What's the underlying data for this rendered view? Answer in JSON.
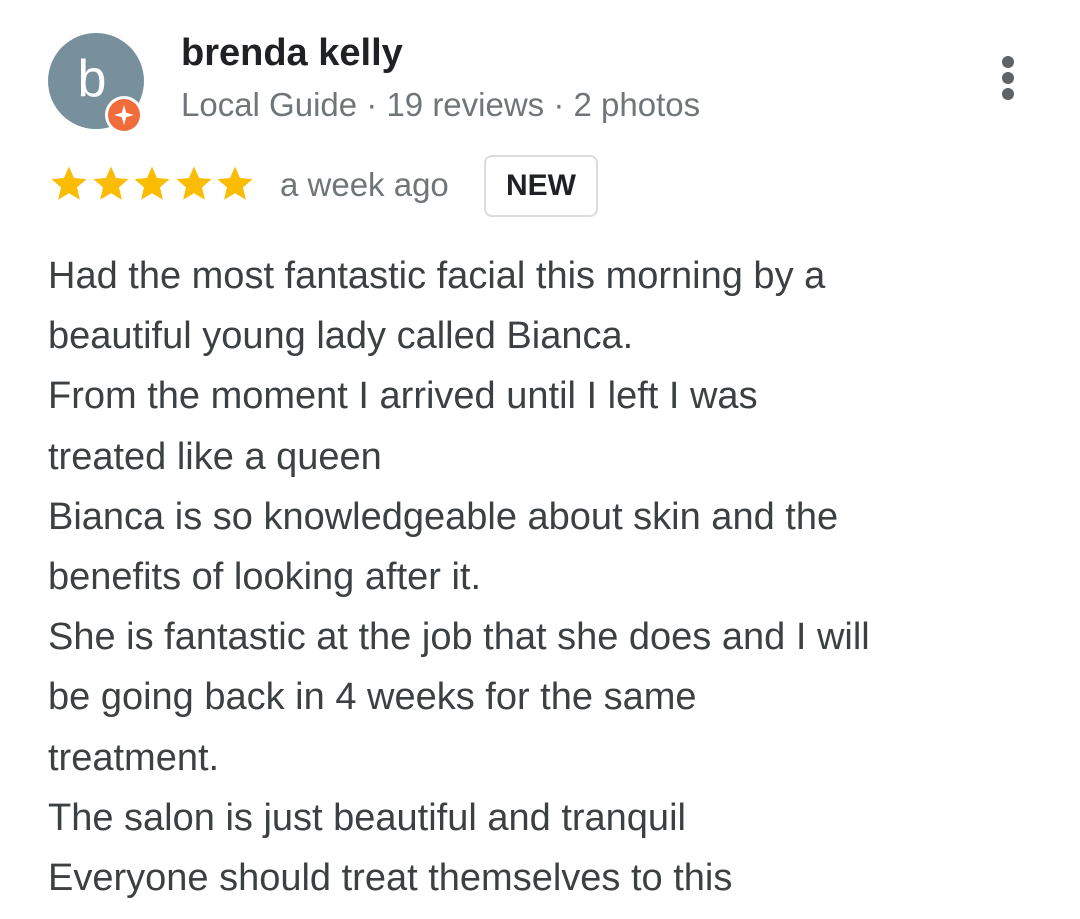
{
  "reviewer": {
    "avatar_letter": "b",
    "avatar_color": "#78909c",
    "name": "brenda kelly",
    "meta": "Local Guide · 19 reviews · 2 photos",
    "badge_icon": "local-guide-star-icon",
    "badge_color": "#f26b3a"
  },
  "menu": {
    "icon": "more-vert-icon"
  },
  "rating": {
    "stars": 5,
    "max_stars": 5,
    "star_color": "#fbbc04",
    "time_ago": "a week ago",
    "badge": "NEW"
  },
  "review": {
    "lines": [
      "Had the most fantastic facial this morning by a",
      "beautiful young lady called Bianca.",
      "From the moment I arrived until I left I was",
      "treated like a queen",
      "Bianca is so knowledgeable about skin and the",
      "benefits of looking after it.",
      "She is fantastic at the job that she does and I will",
      "be going back in 4 weeks for the same",
      "treatment.",
      "The salon is just beautiful and tranquil",
      "Everyone should treat themselves to this"
    ]
  }
}
